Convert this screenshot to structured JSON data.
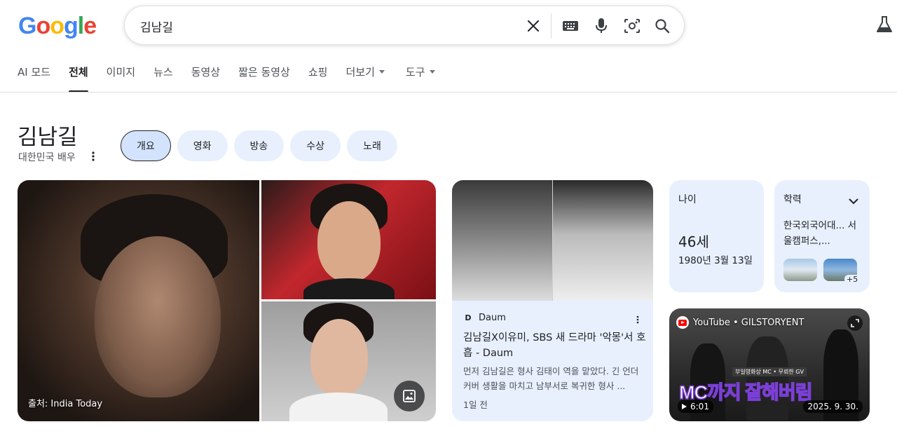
{
  "logo": {
    "letters": [
      "G",
      "o",
      "o",
      "g",
      "l",
      "e"
    ],
    "colors": [
      "#4285f4",
      "#ea4335",
      "#fbbc05",
      "#4285f4",
      "#34a853",
      "#ea4335"
    ]
  },
  "search": {
    "query": "김남길",
    "icons": [
      "close-icon",
      "keyboard-icon",
      "mic-icon",
      "camera-icon",
      "search-icon"
    ]
  },
  "tabs": [
    {
      "label": "AI 모드",
      "active": false
    },
    {
      "label": "전체",
      "active": true
    },
    {
      "label": "이미지",
      "active": false
    },
    {
      "label": "뉴스",
      "active": false
    },
    {
      "label": "동영상",
      "active": false
    },
    {
      "label": "짧은 동영상",
      "active": false
    },
    {
      "label": "쇼핑",
      "active": false
    },
    {
      "label": "더보기",
      "active": false,
      "dropdown": true
    },
    {
      "label": "도구",
      "active": false,
      "dropdown": true
    }
  ],
  "entity": {
    "title": "김남길",
    "subtitle": "대한민국 배우"
  },
  "chips": [
    {
      "label": "개요",
      "active": true
    },
    {
      "label": "영화",
      "active": false
    },
    {
      "label": "방송",
      "active": false
    },
    {
      "label": "수상",
      "active": false
    },
    {
      "label": "노래",
      "active": false
    }
  ],
  "images": {
    "credit": "출처: India Today"
  },
  "news": {
    "source": "Daum",
    "source_logo": "D",
    "title": "김남길X이유미, SBS 새 드라마 '악몽'서 호흡 - Daum",
    "snippet": "먼저 김남길은 형사 김태이 역을 맡았다. 긴 언더커버 생활을 마치고 남부서로 복귀한 형사 ...",
    "time": "1일 전"
  },
  "age": {
    "label": "나이",
    "value": "46세",
    "date": "1980년 3월 13일"
  },
  "education": {
    "label": "학력",
    "value": "한국외국어대... 서울캠퍼스,...",
    "more": "+5"
  },
  "video": {
    "channel": "YouTube • GILSTORYENT",
    "caption_small": "부일영화상 MC • 무뢰한 GV",
    "caption": "MC까지 잘해버림",
    "duration": "6:01",
    "date": "2025. 9. 30."
  }
}
